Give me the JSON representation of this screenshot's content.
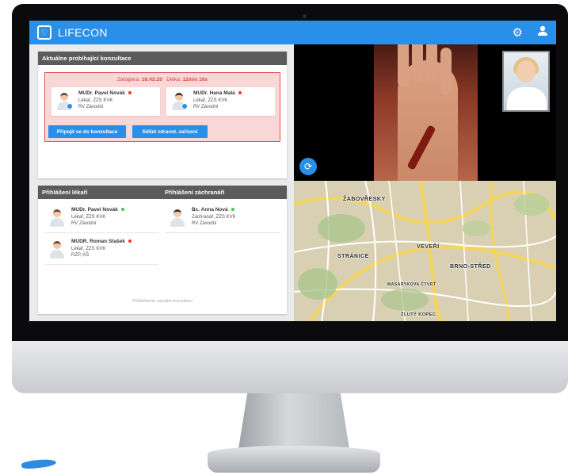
{
  "app": {
    "title": "LIFECON",
    "logo_icon": "heart-icon"
  },
  "header_icons": [
    "gear-icon",
    "user-icon"
  ],
  "consultations": {
    "title": "Aktuálne probíhající konzultace",
    "started_label": "Zahájena:",
    "started_value": "16:43:20",
    "duration_label": "Délka:",
    "duration_value": "12min 10s",
    "participants": [
      {
        "name": "MUDr. Pavel Novák",
        "role": "Lékař, ZZS KVK",
        "place": "RV Závodní",
        "status_color": "#e53935"
      },
      {
        "name": "MUDr. Hana Malá",
        "role": "Lékař, ZZS KVK",
        "place": "RV Závodní",
        "status_color": "#e53935"
      }
    ],
    "join_button": "Připojit se do konzultace",
    "share_button": "Sdílet zdravot. zařízení"
  },
  "logged_in": {
    "doctors_title": "Přihlášení lékaři",
    "rescuers_title": "Přihlášení záchranáři",
    "doctors": [
      {
        "name": "MUDr. Pavel Novák",
        "role": "Lékař, ZZS KVK",
        "place": "RV Závodní",
        "status_color": "#43c35a"
      },
      {
        "name": "MUDR. Roman Stašek",
        "role": "Lékař, ZZS KVK",
        "place": "RZP, AŠ",
        "status_color": "#e53935"
      }
    ],
    "rescuers": [
      {
        "name": "Bc. Anna Nová",
        "role": "Záchranář, ZZS KVK",
        "place": "RV Závodní",
        "status_color": "#43c35a"
      }
    ],
    "note": "Přihlášením zahájíte konzultaci"
  },
  "video": {
    "switch_icon": "camera-switch-icon"
  },
  "map": {
    "labels": [
      "ŽABOVŘESKY",
      "VEVEŘÍ",
      "STRÁNICE",
      "BRNO-STŘED",
      "MASARYKOVA ČTVRŤ",
      "ŽLUTÝ KOPEC"
    ]
  }
}
